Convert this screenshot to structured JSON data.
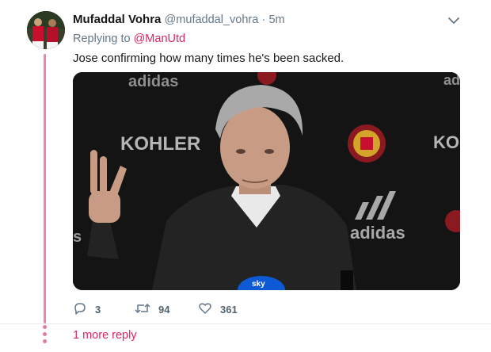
{
  "tweet": {
    "author_name": "Mufaddal Vohra",
    "author_handle": "@mufaddal_vohra",
    "separator": "·",
    "time": "5m",
    "reply_prefix": "Replying to",
    "reply_mention": "@ManUtd",
    "text": "Jose confirming how many times he's been sacked.",
    "media": {
      "backdrop_words": [
        "adidas",
        "KOHLER",
        "KO",
        "adidas",
        "ad",
        "s"
      ],
      "mic_label": "sky"
    },
    "actions": {
      "replies": "3",
      "retweets": "94",
      "likes": "361"
    }
  },
  "thread": {
    "more_replies_label": "1 more reply"
  },
  "colors": {
    "accent": "#e0245e",
    "muted_text": "#657786",
    "background": "#e6ecf0"
  },
  "icons": {
    "menu": "chevron-down-icon",
    "reply": "reply-icon",
    "retweet": "retweet-icon",
    "like": "heart-icon"
  }
}
